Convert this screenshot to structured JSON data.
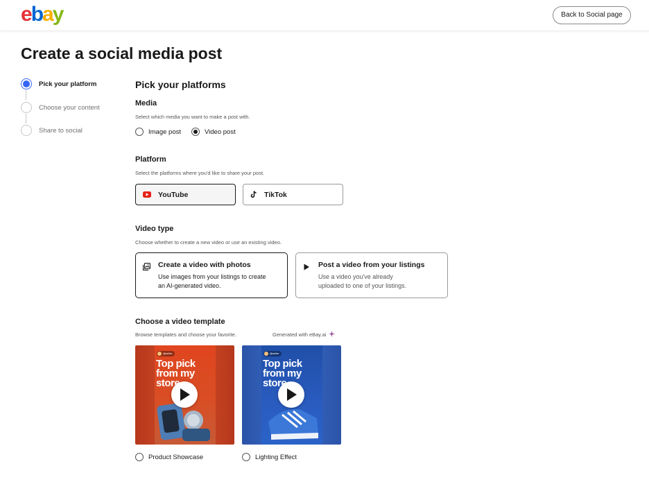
{
  "header": {
    "logo_letters": [
      "e",
      "b",
      "a",
      "y"
    ],
    "logo_colors": [
      "#e53238",
      "#0064d2",
      "#f5af02",
      "#86b817"
    ],
    "back_button": "Back to Social page"
  },
  "page_title": "Create a social media post",
  "stepper": {
    "steps": [
      {
        "label": "Pick your platform",
        "active": true
      },
      {
        "label": "Choose your content",
        "active": false
      },
      {
        "label": "Share to social",
        "active": false
      }
    ]
  },
  "main": {
    "heading": "Pick your platforms",
    "media": {
      "title": "Media",
      "subtitle": "Select which media you want to make a post with.",
      "options": [
        {
          "label": "Image post",
          "checked": false
        },
        {
          "label": "Video post",
          "checked": true
        }
      ]
    },
    "platform": {
      "title": "Platform",
      "subtitle": "Select the platforms where you'd like to share your post.",
      "options": [
        {
          "label": "YouTube",
          "selected": true,
          "icon": "youtube-icon"
        },
        {
          "label": "TikTok",
          "selected": false,
          "icon": "tiktok-icon"
        }
      ]
    },
    "video_type": {
      "title": "Video type",
      "subtitle": "Choose whether to create a new video or use an existing video.",
      "options": [
        {
          "title": "Create a video with photos",
          "desc_line1": "Use images from your listings to create",
          "desc_line2": "an AI-generated video.",
          "selected": true,
          "icon": "photos-icon"
        },
        {
          "title": "Post a video from your listings",
          "desc_line1": "Use a video you've already",
          "desc_line2": "uploaded to one of your listings.",
          "selected": false,
          "icon": "play-icon"
        }
      ]
    },
    "template": {
      "title": "Choose a video template",
      "subtitle": "Browse templates and choose your favorite.",
      "generated_label": "Generated with eBay.ai",
      "options": [
        {
          "label": "Product Showcase",
          "thumb_text": "Top pick from my store",
          "handle": "@seller",
          "checked": false
        },
        {
          "label": "Lighting Effect",
          "thumb_text": "Top pick from my store",
          "handle": "@seller",
          "checked": false
        }
      ]
    }
  }
}
